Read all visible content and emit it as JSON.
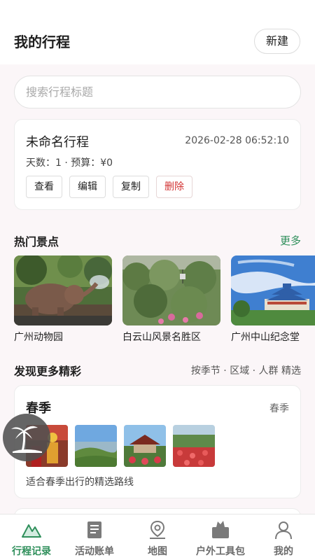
{
  "header": {
    "title": "我的行程",
    "new_label": "新建"
  },
  "search": {
    "placeholder": "搜索行程标题"
  },
  "trip": {
    "name": "未命名行程",
    "datetime": "2026-02-28 06:52:10",
    "meta": "天数：1 · 预算：¥0",
    "actions": [
      "查看",
      "编辑",
      "复制",
      "删除"
    ]
  },
  "hot": {
    "title": "热门景点",
    "more": "更多",
    "items": [
      {
        "caption": "广州动物园",
        "icon": "elephant-photo"
      },
      {
        "caption": "白云山风景名胜区",
        "icon": "mountain-forest-photo"
      },
      {
        "caption": "广州中山纪念堂",
        "icon": "memorial-hall-photo"
      }
    ]
  },
  "discover": {
    "title": "发现更多精彩",
    "links": "按季节 · 区域 · 人群 精选"
  },
  "season": {
    "name": "春季",
    "tag": "春季",
    "description": "适合春季出行的精选路线",
    "thumbs": [
      "festival-photo",
      "valley-view-photo",
      "garden-pavilion-photo",
      "flower-field-photo"
    ]
  },
  "fab": {
    "icon": "palm-beach-icon"
  },
  "tabs": [
    {
      "label": "行程记录",
      "icon": "mountain-icon",
      "active": true
    },
    {
      "label": "活动账单",
      "icon": "bill-icon",
      "active": false
    },
    {
      "label": "地图",
      "icon": "map-pin-icon",
      "active": false
    },
    {
      "label": "户外工具包",
      "icon": "toolkit-icon",
      "active": false
    },
    {
      "label": "我的",
      "icon": "user-icon",
      "active": false
    }
  ],
  "colors": {
    "accent": "#2f8f5b",
    "danger": "#d23333",
    "background": "#fbf6f8"
  }
}
